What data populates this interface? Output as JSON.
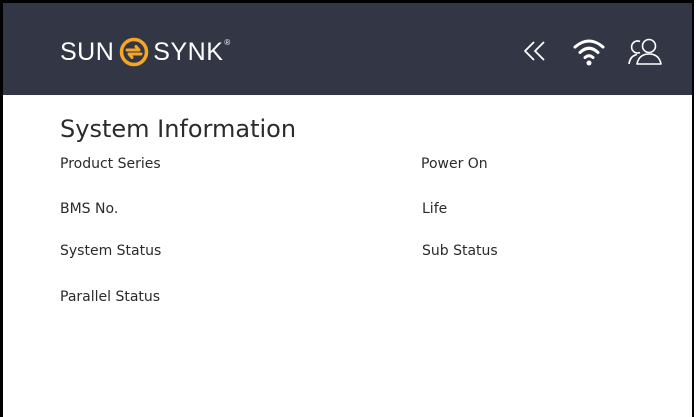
{
  "header": {
    "brand_left": "SUN",
    "brand_right": "SYNK",
    "brand_reg": "®",
    "icons": [
      "double-chevron-left-icon",
      "wifi-icon",
      "users-icon"
    ],
    "colors": {
      "bar": "#333745",
      "logo": "#f5a623"
    }
  },
  "page": {
    "title": "System Information",
    "fields": {
      "product_series": "Product Series",
      "power_on": "Power On",
      "bms_no": "BMS No.",
      "life": "Life",
      "system_status": "System Status",
      "sub_status": "Sub Status",
      "parallel_status": "Parallel Status"
    }
  }
}
